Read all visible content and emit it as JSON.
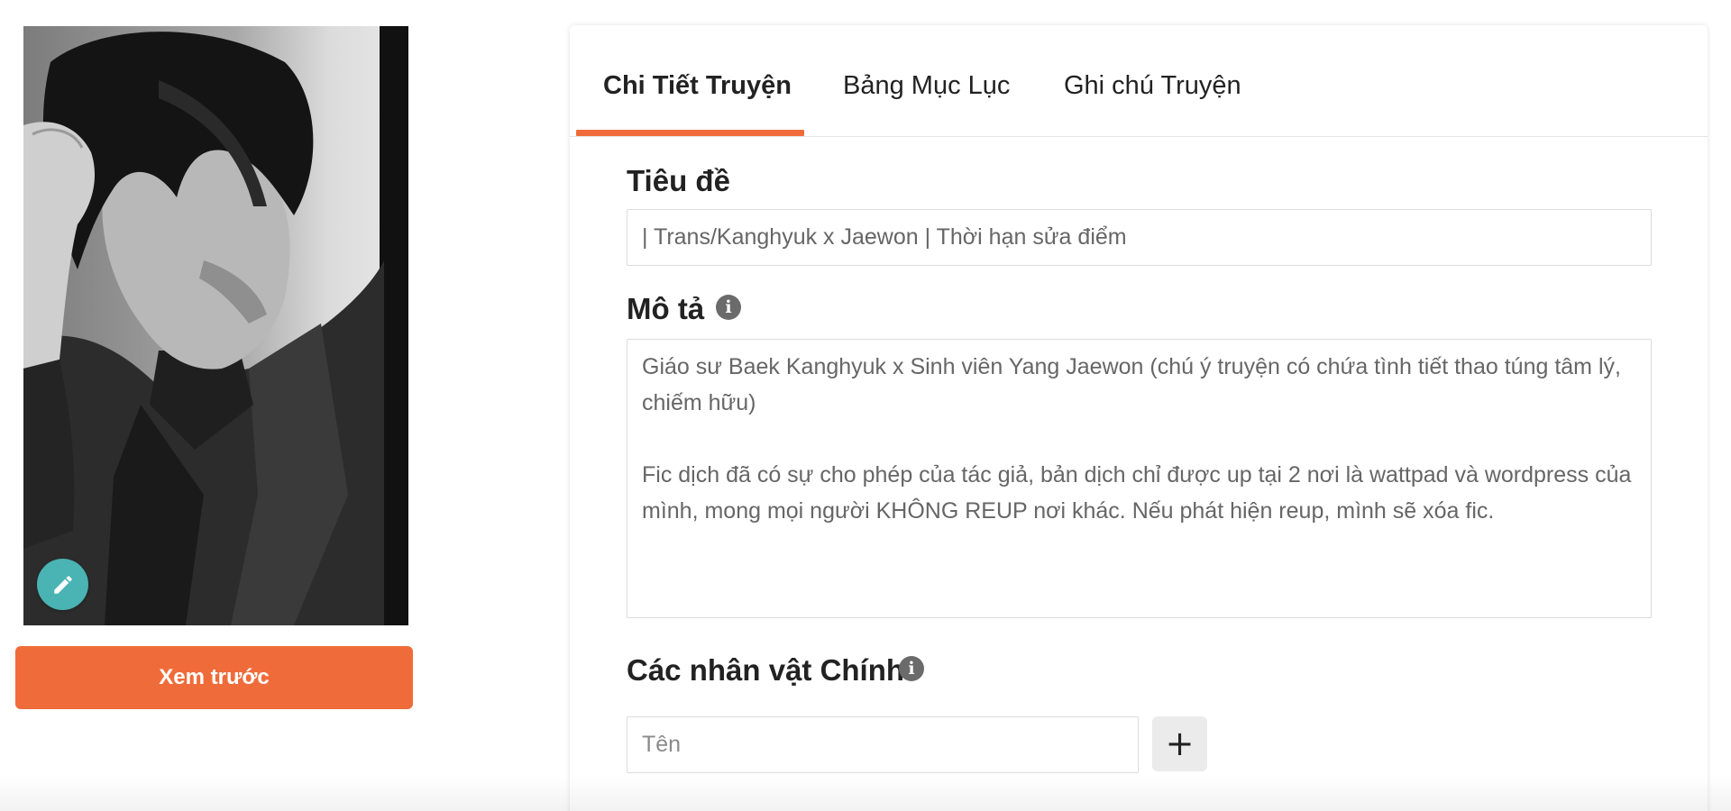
{
  "left": {
    "cover_alt": "story cover image",
    "edit_icon": "pencil-icon",
    "preview_button": "Xem trước"
  },
  "tabs": [
    {
      "label": "Chi Tiết Truyện",
      "active": true
    },
    {
      "label": "Bảng Mục Lục",
      "active": false
    },
    {
      "label": "Ghi chú Truyện",
      "active": false
    }
  ],
  "form": {
    "title_label": "Tiêu đề",
    "title_value": "| Trans/Kanghyuk x Jaewon | Thời hạn sửa điểm",
    "description_label": "Mô tả",
    "description_value": "Giáo sư Baek Kanghyuk x Sinh viên Yang Jaewon (chú ý truyện có chứa tình tiết thao túng tâm lý,\nchiếm hữu)\n\nFic dịch đã có sự cho phép của tác giả, bản dịch chỉ được up tại 2 nơi là wattpad và wordpress của\nmình, mong mọi người KHÔNG REUP nơi khác. Nếu phát hiện reup, mình sẽ xóa fic.",
    "characters_label": "Các nhân vật Chính",
    "name_placeholder": "Tên",
    "add_symbol": "+",
    "info_symbol": "i"
  },
  "colors": {
    "accent": "#ef6c3a",
    "edit_button": "#4ab3b3",
    "info_icon": "#6b6b6b"
  }
}
